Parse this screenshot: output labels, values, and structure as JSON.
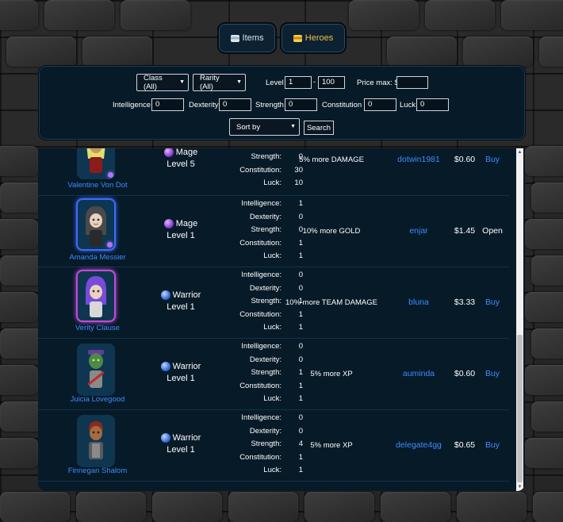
{
  "tabs": [
    {
      "label": "Items",
      "icon": "coin-stack-icon",
      "color": "#d8e4ee"
    },
    {
      "label": "Heroes",
      "icon": "coin-stack-icon",
      "color": "#f0c040"
    }
  ],
  "filters": {
    "class_dropdown": "Class (All)",
    "rarity_dropdown": "Rarity (All)",
    "level_label": "Level",
    "level_min": "1",
    "level_dash": "-",
    "level_max": "100",
    "price_max_label": "Price max: $",
    "price_max_value": "",
    "intelligence_label": "Intelligence",
    "intelligence_value": "0",
    "dexterity_label": "Dexterity",
    "dexterity_value": "0",
    "strength_label": "Strength",
    "strength_value": "0",
    "constitution_label": "Constitution",
    "constitution_value": "0",
    "luck_label": "Luck",
    "luck_value": "0",
    "sort_dropdown": "Sort by",
    "search_button": "Search"
  },
  "stat_labels": {
    "intelligence": "Intelligence:",
    "dexterity": "Dexterity:",
    "strength": "Strength:",
    "constitution": "Constitution:",
    "luck": "Luck:"
  },
  "heroes": [
    {
      "name": "Valentine Von Dot",
      "class": "Mage",
      "class_icon": "mage-orb-icon",
      "level": "Level 5",
      "stats": {
        "strength": "0",
        "constitution": "30",
        "luck": "10"
      },
      "bonus": "5% more DAMAGE",
      "seller": "dotwin1981",
      "price": "$0.60",
      "action": "Buy"
    },
    {
      "name": "Amanda Messier",
      "class": "Mage",
      "class_icon": "mage-orb-icon",
      "level": "Level 1",
      "stats": {
        "intelligence": "1",
        "dexterity": "0",
        "strength": "0",
        "constitution": "1",
        "luck": "1"
      },
      "bonus": "10% more GOLD",
      "seller": "enjar",
      "price": "$1.45",
      "action": "Open"
    },
    {
      "name": "Verity Clause",
      "class": "Warrior",
      "class_icon": "warrior-orb-icon",
      "level": "Level 1",
      "stats": {
        "intelligence": "0",
        "dexterity": "0",
        "strength": "1",
        "constitution": "1",
        "luck": "1"
      },
      "bonus": "10% more TEAM DAMAGE",
      "seller": "bluna",
      "price": "$3.33",
      "action": "Buy"
    },
    {
      "name": "Juicia Lovegood",
      "class": "Warrior",
      "class_icon": "warrior-orb-icon",
      "level": "Level 1",
      "stats": {
        "intelligence": "0",
        "dexterity": "0",
        "strength": "1",
        "constitution": "1",
        "luck": "1"
      },
      "bonus": "5% more XP",
      "seller": "auminda",
      "price": "$0.60",
      "action": "Buy"
    },
    {
      "name": "Finnegan Shalom",
      "class": "Warrior",
      "class_icon": "warrior-orb-icon",
      "level": "Level 1",
      "stats": {
        "intelligence": "0",
        "dexterity": "0",
        "strength": "4",
        "constitution": "1",
        "luck": "1"
      },
      "bonus": "5% more XP",
      "seller": "delegate4gg",
      "price": "$0.65",
      "action": "Buy"
    }
  ],
  "colors": {
    "panel": "#071a28",
    "link": "#3d8dff",
    "rare_border": "#3d6bff",
    "epic_border": "#c24bd6",
    "mage_gem": "#b073ff"
  }
}
